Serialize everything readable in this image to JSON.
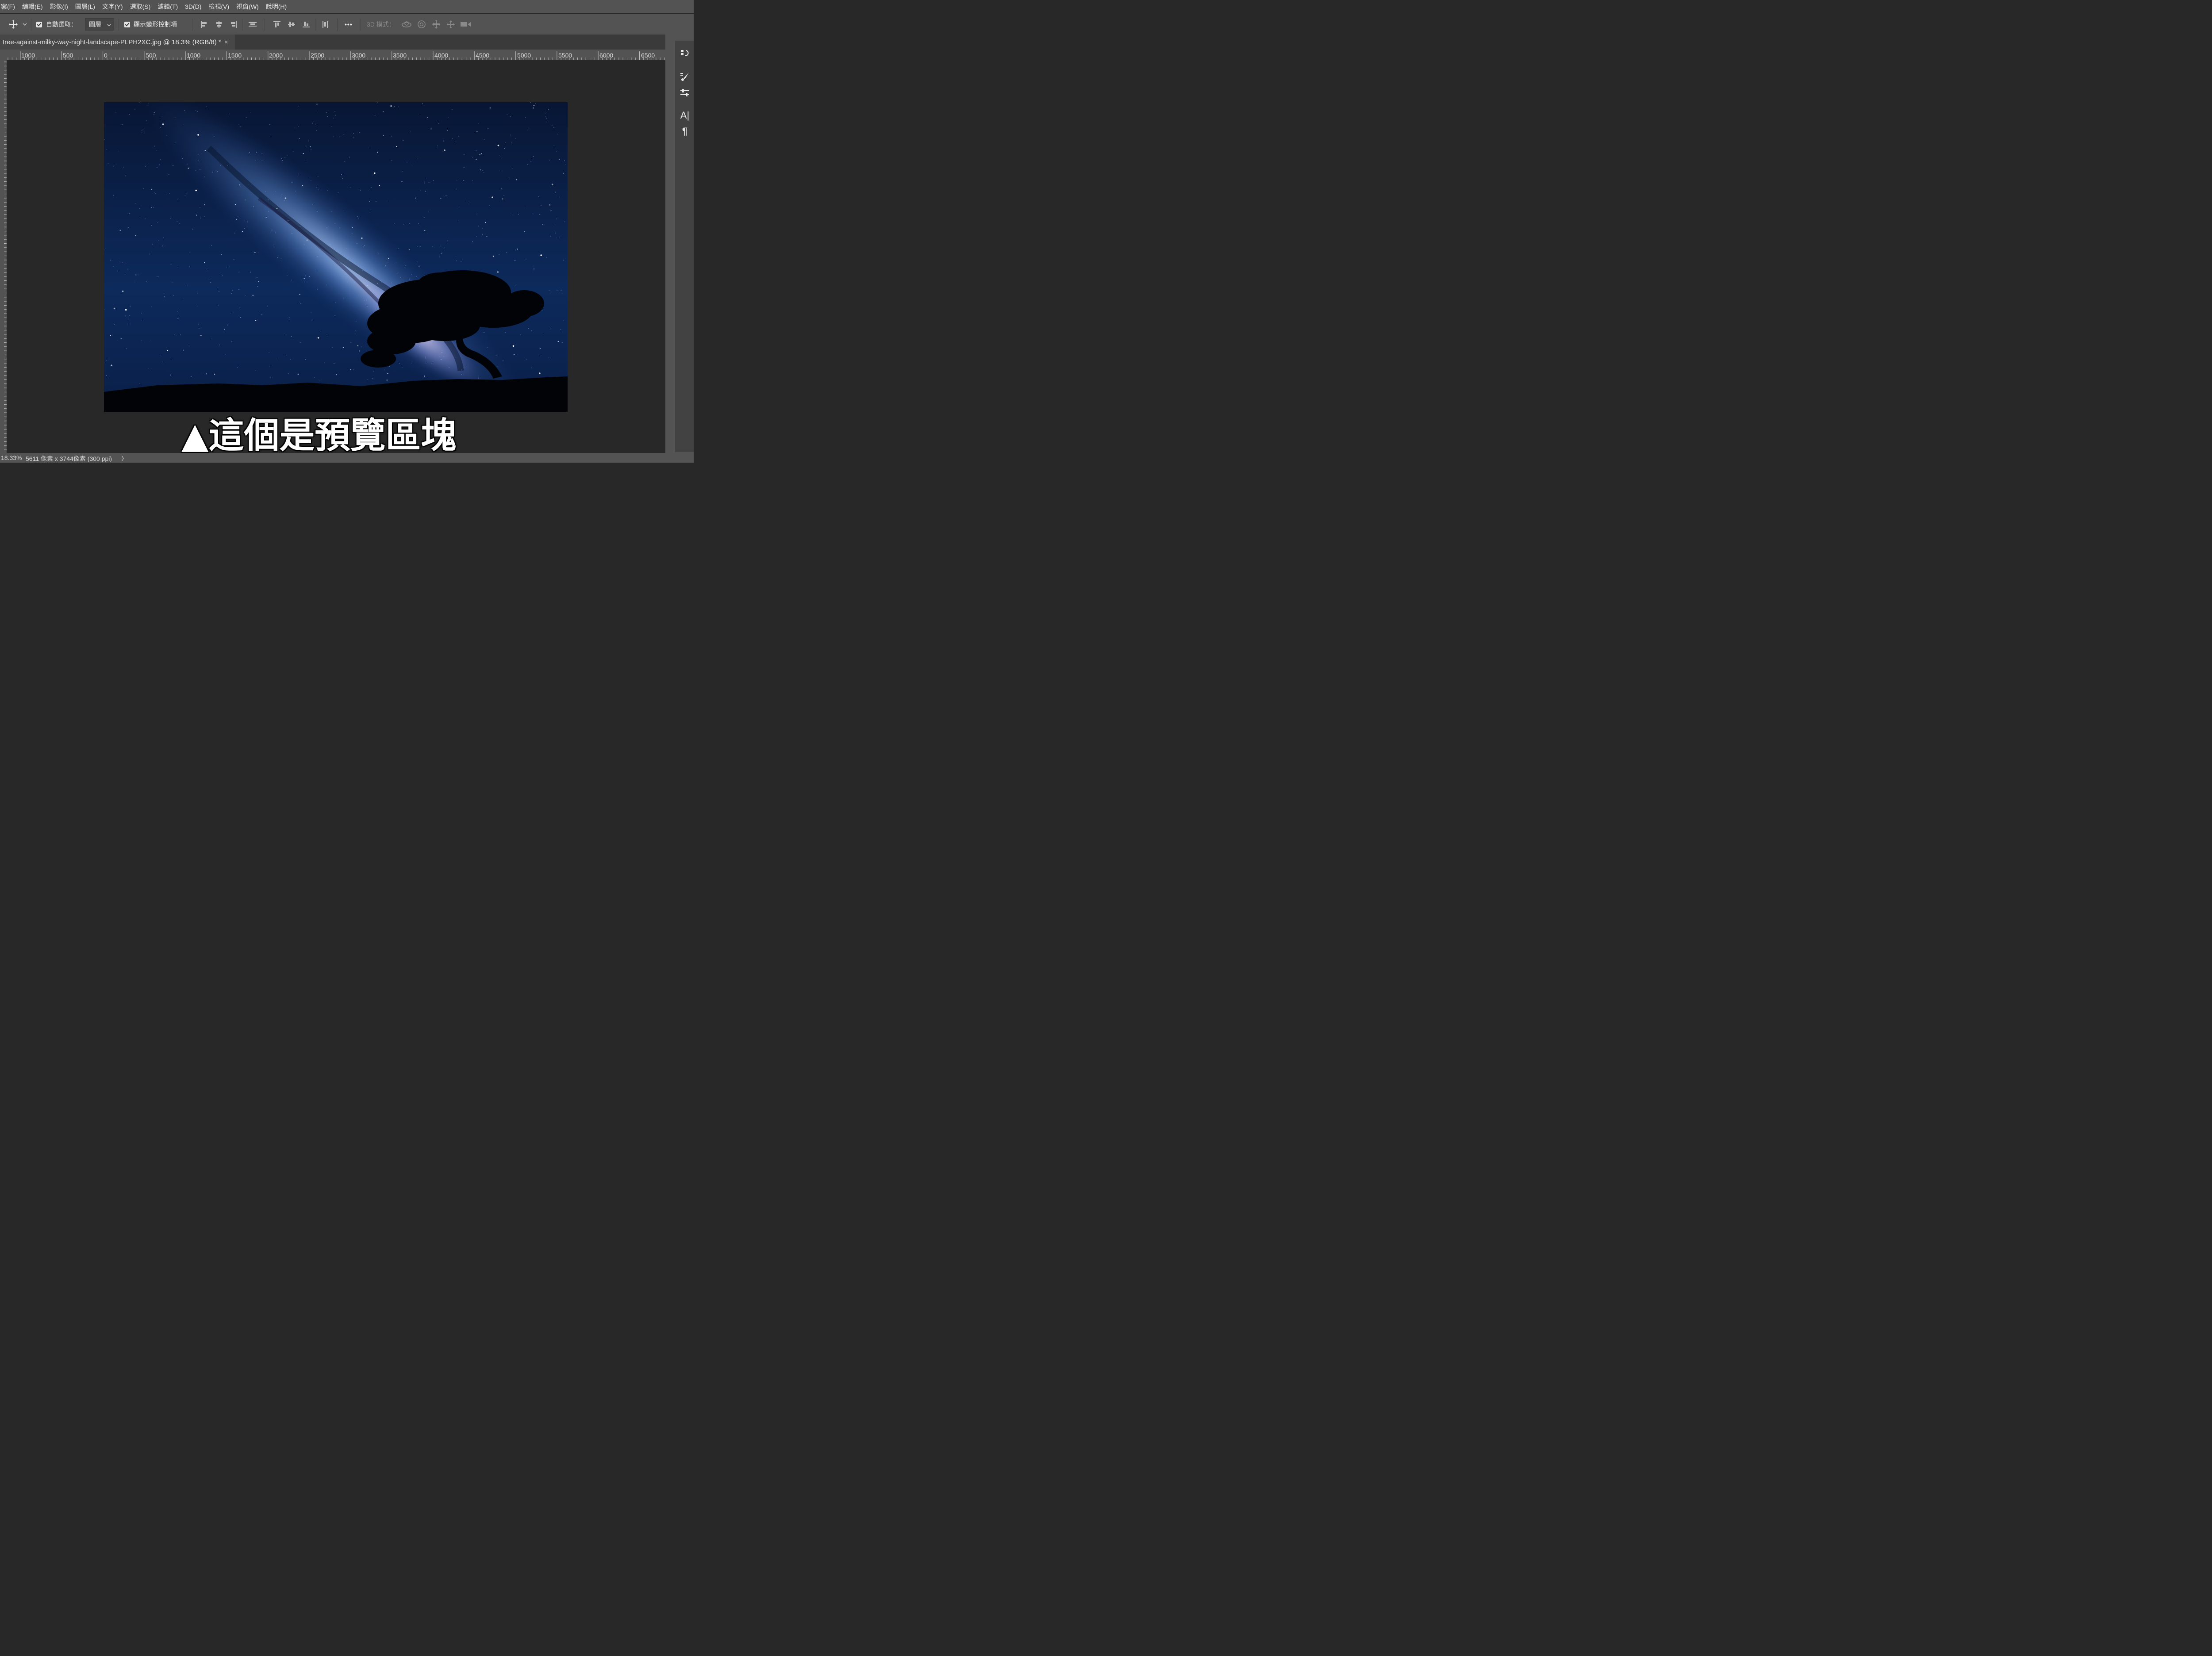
{
  "menu": [
    "案(F)",
    "編輯(E)",
    "影像(I)",
    "圖層(L)",
    "文字(Y)",
    "選取(S)",
    "濾鏡(T)",
    "3D(D)",
    "檢視(V)",
    "視窗(W)",
    "說明(H)"
  ],
  "options": {
    "move_tool_icon": "move-arrows-icon",
    "auto_select_label": "自動選取：",
    "auto_select_checked": true,
    "auto_select_target": "圖層",
    "show_transform_label": "顯示變形控制項",
    "show_transform_checked": true,
    "more_label": "•••",
    "mode_3d_label": "3D 模式："
  },
  "document_tab": {
    "title": "tree-against-milky-way-night-landscape-PLPH2XC.jpg @ 18.3% (RGB/8) *",
    "close_glyph": "×"
  },
  "ruler_labels": [
    "1000",
    "500",
    "0",
    "500",
    "1000",
    "1500",
    "2000",
    "2500",
    "3000",
    "3500",
    "4000",
    "4500",
    "5000",
    "5500",
    "6000",
    "6500"
  ],
  "right_panel": {
    "buttons": [
      "history-icon",
      "brush-settings-icon",
      "properties-icon",
      "character-icon",
      "paragraph-icon"
    ],
    "character_glyph": "A|",
    "paragraph_glyph": "¶"
  },
  "status": {
    "zoom": "18.33%",
    "doc_info": "5611 像素 x 3744像素 (300 ppi)",
    "arrow": "〉"
  },
  "caption": "▲這個是預覽區塊",
  "colors": {
    "ui_dark": "#535353",
    "canvas": "#282828",
    "sky": "#0a1a3a"
  }
}
